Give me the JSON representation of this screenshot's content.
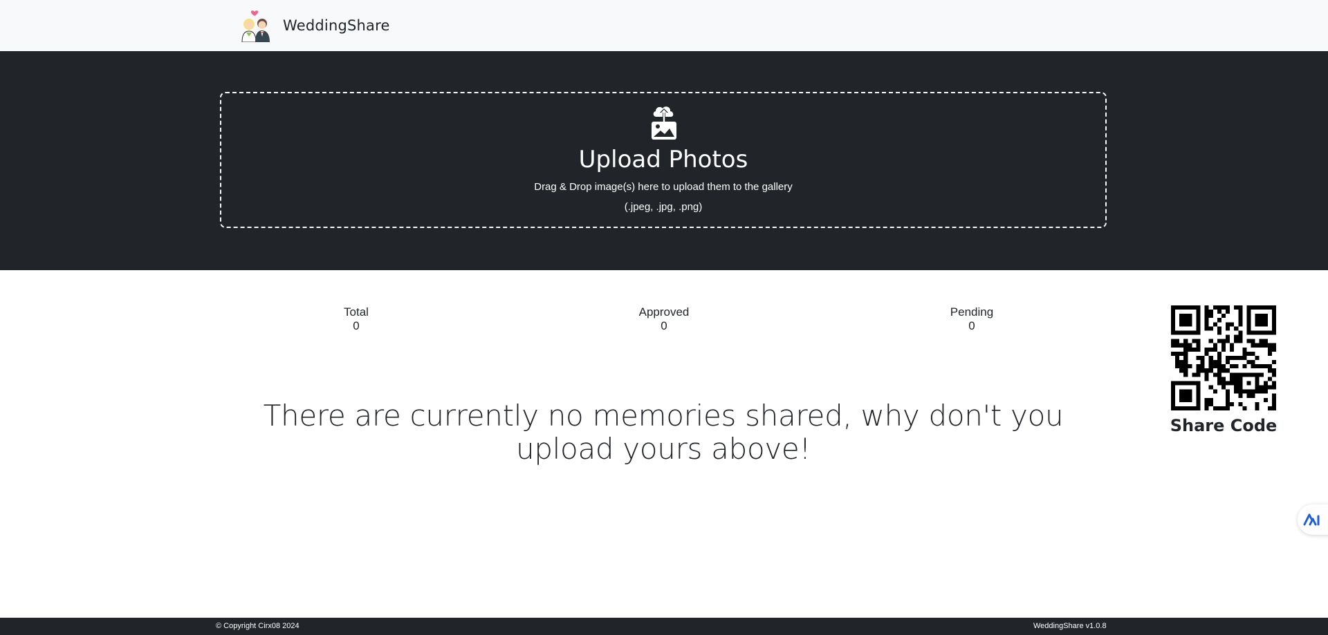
{
  "navbar": {
    "brand": "WeddingShare"
  },
  "upload": {
    "title": "Upload Photos",
    "subtitle": "Drag & Drop image(s) here to upload them to the gallery",
    "types": "(.jpeg, .jpg, .png)",
    "icon": "cloud-upload-image-icon"
  },
  "stats": [
    {
      "label": "Total",
      "value": "0"
    },
    {
      "label": "Approved",
      "value": "0"
    },
    {
      "label": "Pending",
      "value": "0"
    }
  ],
  "empty_message": "There are currently no memories shared, why don't you upload yours above!",
  "share": {
    "label": "Share Code",
    "icon": "qr-code-icon"
  },
  "footer": {
    "copyright": "© Copyright Cirx08 2024",
    "version": "WeddingShare v1.0.8"
  },
  "colors": {
    "navbar_bg": "#f8f9fa",
    "hero_bg": "#212529",
    "text": "#212529",
    "float_icon": "#1a5fd6"
  }
}
